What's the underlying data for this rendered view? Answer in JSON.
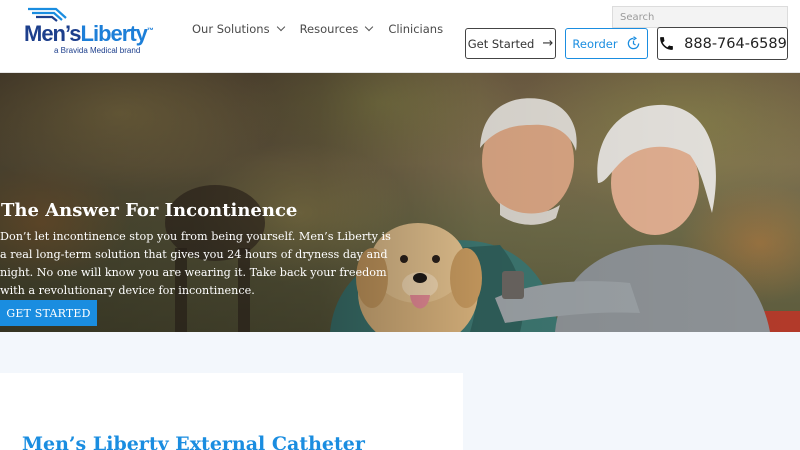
{
  "brand": {
    "name_part1": "Men’s",
    "name_part2": "Liberty",
    "trademark": "™",
    "sub": "a Bravida Medical brand",
    "primary_color": "#1d3f8c",
    "accent_color": "#1a8de0"
  },
  "nav": {
    "items": [
      {
        "label": "Our Solutions",
        "has_dropdown": true
      },
      {
        "label": "Resources",
        "has_dropdown": true
      },
      {
        "label": "Clinicians",
        "has_dropdown": false
      }
    ]
  },
  "search": {
    "placeholder": "Search"
  },
  "header_buttons": {
    "get_started": {
      "label": "Get Started",
      "icon": "arrow-right-icon"
    },
    "reorder": {
      "label": "Reorder",
      "icon": "refresh-clock-icon"
    },
    "phone": {
      "label": "888-764-6589",
      "icon": "phone-icon"
    }
  },
  "hero": {
    "title": "The Answer For Incontinence",
    "text": "Don’t let incontinence stop you from being yourself. Men’s Liberty is a real long-term solution that gives you 24 hours of dryness day and night. No one will know you are wearing it. Take back your freedom with a revolutionary device for incontinence.",
    "cta": "Get Started",
    "image_desc_icon": "couple-with-dog-photo"
  },
  "section": {
    "title": "Men’s Liberty External Catheter"
  }
}
